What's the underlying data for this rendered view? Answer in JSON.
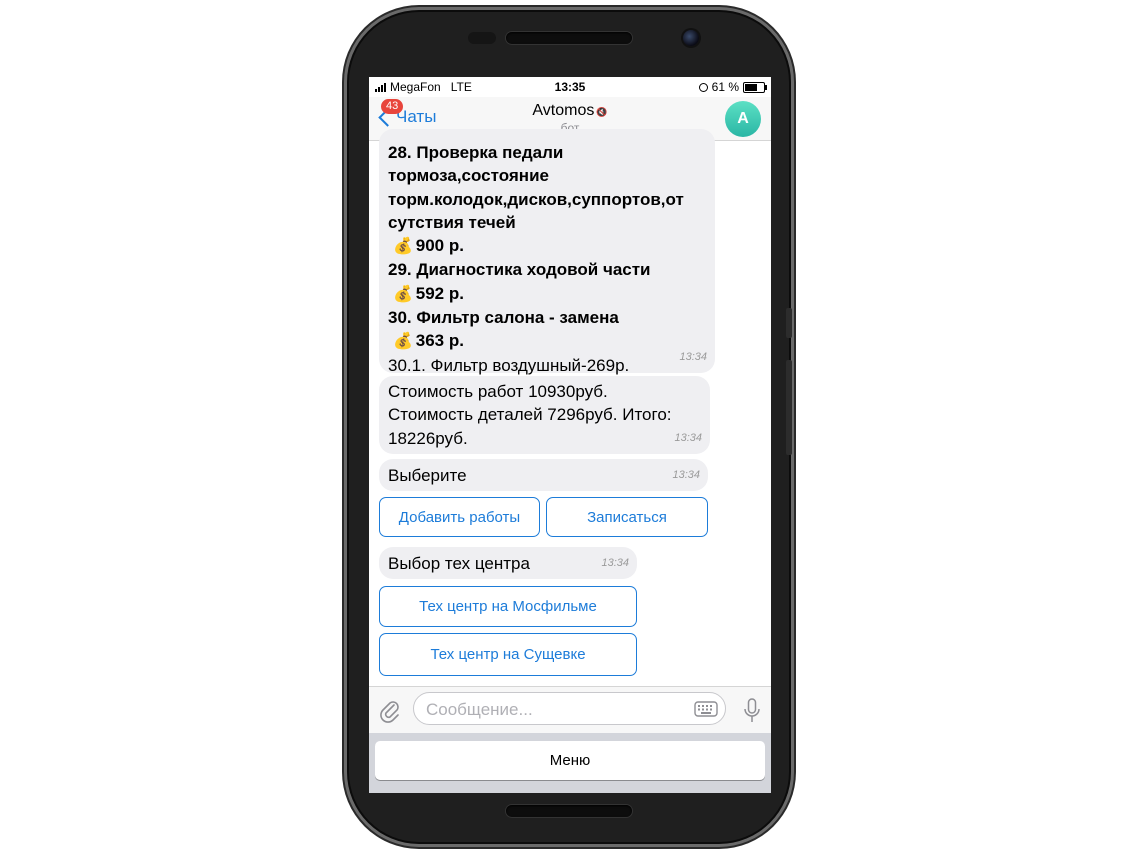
{
  "status_bar": {
    "carrier": "MegaFon",
    "network": "LTE",
    "time": "13:35",
    "battery": "61 %"
  },
  "header": {
    "back_label": "Чаты",
    "unread_badge": "43",
    "title": "Avtomos",
    "subtitle": "бот",
    "avatar_letter": "A"
  },
  "messages": {
    "m1": {
      "lines": {
        "l1": "28. Проверка педали",
        "l2": "тормоза,состояние",
        "l3": "торм.колодок,дисков,суппортов,от",
        "l4": "сутствия течей",
        "l5": "900 р.",
        "l6": "29. Диагностика ходовой части",
        "l7": "592 р.",
        "l8": "30. Фильтр салона - замена",
        "l9": "363 р.",
        "l10": "30.1. Фильтр воздушный-269р."
      },
      "bag_icon": "💰",
      "time": "13:34"
    },
    "m2": {
      "l1": "Стоимость работ 10930руб.",
      "l2": "Стоимость деталей 7296руб. Итого:",
      "l3": "18226руб.",
      "time": "13:34"
    },
    "m3": {
      "text": "Выберите",
      "time": "13:34"
    },
    "m4": {
      "text": "Выбор тех центра",
      "time": "13:34"
    }
  },
  "buttons": {
    "add_works": "Добавить работы",
    "sign_up": "Записаться",
    "mosfilm": "Тех центр на Мосфильме",
    "sushchevka": "Тех центр на Сущевке"
  },
  "input": {
    "placeholder": "Сообщение..."
  },
  "menu": {
    "label": "Меню"
  },
  "colors": {
    "accent": "#1d7cd9",
    "badge": "#e8453c",
    "bubble": "#efeff2",
    "avatar": "#3ccdb5"
  }
}
